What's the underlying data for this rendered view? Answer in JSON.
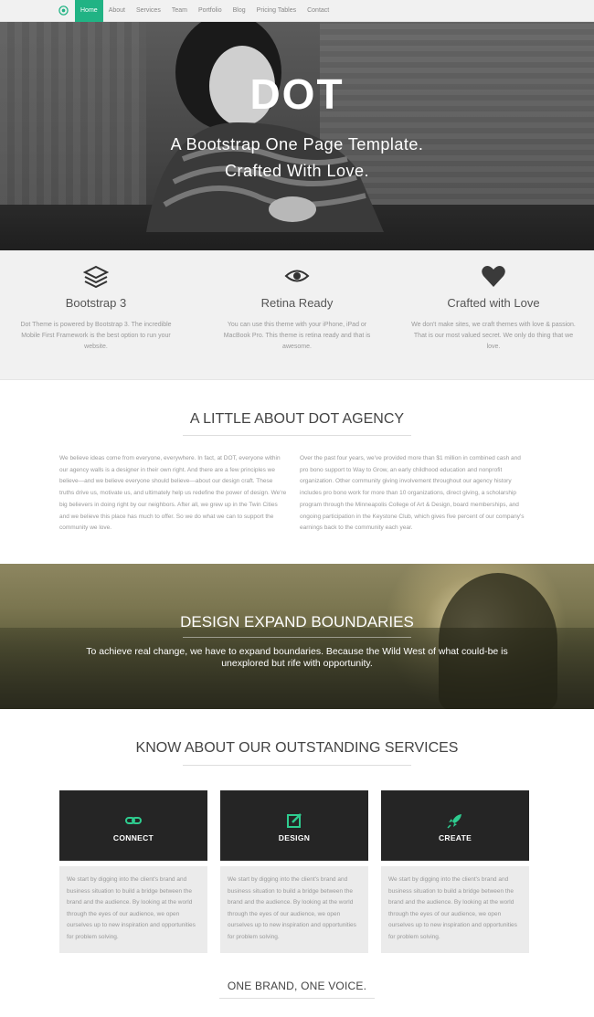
{
  "nav": {
    "items": [
      "Home",
      "About",
      "Services",
      "Team",
      "Portfolio",
      "Blog",
      "Pricing Tables",
      "Contact"
    ],
    "active": "Home"
  },
  "hero": {
    "logo": "DOT",
    "tagline_line1": "A Bootstrap One Page Template.",
    "tagline_line2": "Crafted With Love."
  },
  "features": [
    {
      "icon": "layers-icon",
      "title": "Bootstrap 3",
      "text": "Dot Theme is powered by Bootstrap 3. The incredible Mobile First Framework is the best option to run your website."
    },
    {
      "icon": "eye-icon",
      "title": "Retina Ready",
      "text": "You can use this theme with your iPhone, iPad or MacBook Pro. This theme is retina ready and that is awesome."
    },
    {
      "icon": "heart-icon",
      "title": "Crafted with Love",
      "text": "We don't make sites, we craft themes with love & passion. That is our most valued secret. We only do thing that we love."
    }
  ],
  "about": {
    "title": "A LITTLE ABOUT DOT AGENCY",
    "col1": "We believe ideas come from everyone, everywhere. In fact, at DOT, everyone within our agency walls is a designer in their own right. And there are a few principles we believe—and we believe everyone should believe—about our design craft. These truths drive us, motivate us, and ultimately help us redefine the power of design. We're big believers in doing right by our neighbors. After all, we grew up in the Twin Cities and we believe this place has much to offer. So we do what we can to support the community we love.",
    "col2": "Over the past four years, we've provided more than $1 million in combined cash and pro bono support to Way to Grow, an early childhood education and nonprofit organization. Other community giving involvement throughout our agency history includes pro bono work for more than 10 organizations, direct giving, a scholarship program through the Minneapolis College of Art & Design, board memberships, and ongoing participation in the Keystone Club, which gives five percent of our company's earnings back to the community each year."
  },
  "banner": {
    "title": "DESIGN EXPAND BOUNDARIES",
    "text": "To achieve real change, we have to expand boundaries. Because the Wild West of what could-be is unexplored but rife with opportunity."
  },
  "services": {
    "title": "KNOW ABOUT OUR OUTSTANDING SERVICES",
    "accent": "#2ecc8f",
    "items": [
      {
        "icon": "link-icon",
        "label": "CONNECT",
        "text": "We start by digging into the client's brand and business situation to build a bridge between the brand and the audience. By looking at the world through the eyes of our audience, we open ourselves up to new inspiration and opportunities for problem solving."
      },
      {
        "icon": "edit-icon",
        "label": "DESIGN",
        "text": "We start by digging into the client's brand and business situation to build a bridge between the brand and the audience. By looking at the world through the eyes of our audience, we open ourselves up to new inspiration and opportunities for problem solving."
      },
      {
        "icon": "rocket-icon",
        "label": "CREATE",
        "text": "We start by digging into the client's brand and business situation to build a bridge between the brand and the audience. By looking at the world through the eyes of our audience, we open ourselves up to new inspiration and opportunities for problem solving."
      }
    ]
  },
  "brand": {
    "title": "ONE BRAND, ONE VOICE."
  }
}
